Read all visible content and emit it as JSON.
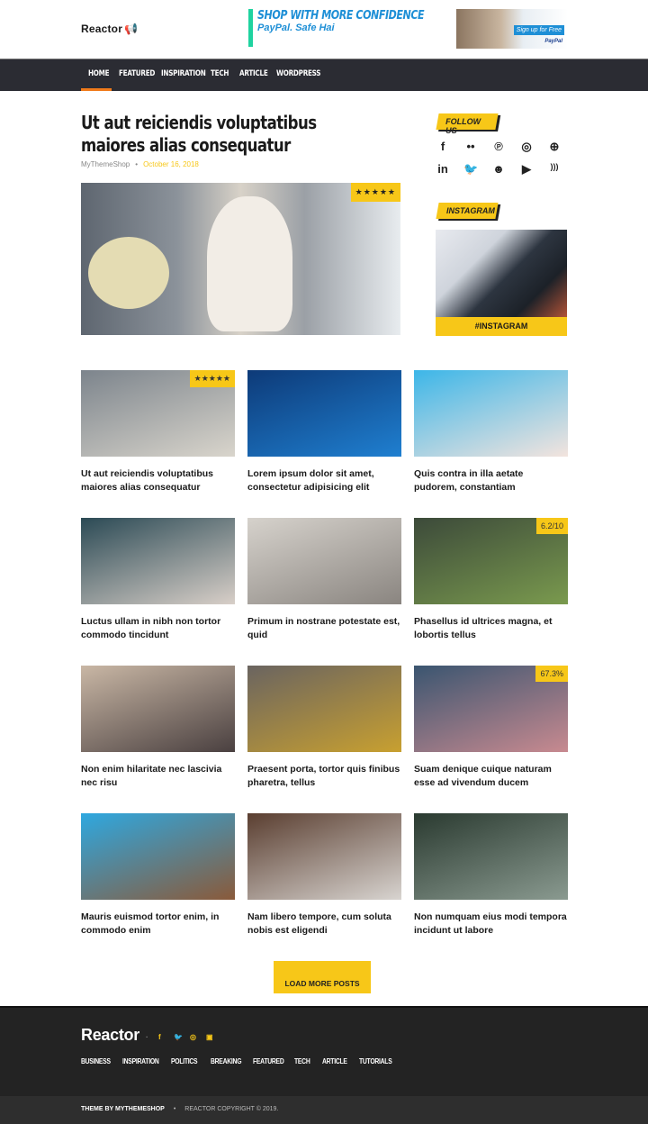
{
  "header": {
    "logo": "Reactor",
    "ad1_line1": "SHOP WITH MORE CONFIDENCE",
    "ad1_line2": "PayPal. Safe Hai",
    "ad2_cta": "Sign up for Free",
    "ad2_brand": "PayPal"
  },
  "nav": [
    "HOME",
    "FEATURED",
    "INSPIRATION",
    "TECH",
    "ARTICLE",
    "WORDPRESS"
  ],
  "featured": {
    "title": "Ut aut reiciendis voluptatibus maiores alias consequatur",
    "author": "MyThemeShop",
    "date": "October 16, 2018",
    "rating": "★★★★★"
  },
  "sidebar": {
    "follow_title": "FOLLOW US",
    "social": [
      "facebook-icon",
      "flickr-icon",
      "pinterest-icon",
      "instagram-icon",
      "dribbble-icon",
      "linkedin-icon",
      "twitter-icon",
      "github-icon",
      "youtube-icon",
      "rss-icon"
    ],
    "instagram_title": "INSTAGRAM",
    "instagram_tag": "#INSTAGRAM"
  },
  "posts": [
    {
      "title": "Ut aut reiciendis voluptatibus maiores alias consequatur",
      "badge": "★★★★★",
      "colors": [
        "#7c848c",
        "#d9d5cc"
      ]
    },
    {
      "title": "Lorem ipsum dolor sit amet, consectetur adipisicing elit",
      "badge": "",
      "colors": [
        "#0d3a78",
        "#1f7fd0"
      ]
    },
    {
      "title": "Quis contra in illa aetate pudorem, constantiam",
      "badge": "",
      "colors": [
        "#3cb6e8",
        "#f3e4de"
      ]
    },
    {
      "title": "Luctus ullam in nibh non tortor commodo tincidunt",
      "badge": "",
      "colors": [
        "#2b4a55",
        "#d8cfc8"
      ]
    },
    {
      "title": "Primum in nostrane potestate est, quid",
      "badge": "",
      "colors": [
        "#d6d2cc",
        "#8a8580"
      ]
    },
    {
      "title": "Phasellus id ultrices magna, et lobortis tellus",
      "badge": "6.2/10",
      "colors": [
        "#3c4a3a",
        "#7a9a4e"
      ]
    },
    {
      "title": "Non enim hilaritate nec lascivia nec risu",
      "badge": "",
      "colors": [
        "#c9b7a5",
        "#4a4040"
      ]
    },
    {
      "title": "Praesent porta, tortor quis finibus pharetra, tellus",
      "badge": "",
      "colors": [
        "#6a6460",
        "#c8a030"
      ]
    },
    {
      "title": "Suam denique cuique naturam esse ad vivendum ducem",
      "badge": "67.3%",
      "colors": [
        "#3a5570",
        "#c88a90"
      ]
    },
    {
      "title": "Mauris euismod tortor enim, in commodo enim",
      "badge": "",
      "colors": [
        "#2ea8e0",
        "#8a5a3a"
      ]
    },
    {
      "title": "Nam libero tempore, cum soluta nobis est eligendi",
      "badge": "",
      "colors": [
        "#5a3e30",
        "#d8d4d0"
      ]
    },
    {
      "title": "Non numquam eius modi tempora incidunt ut labore",
      "badge": "",
      "colors": [
        "#2a3a30",
        "#8a9a90"
      ]
    }
  ],
  "load_more": "LOAD MORE POSTS",
  "footer": {
    "logo": "Reactor",
    "nav": [
      "BUSINESS",
      "INSPIRATION",
      "POLITICS",
      "BREAKING",
      "FEATURED",
      "TECH",
      "ARTICLE",
      "TUTORIALS"
    ],
    "theme_by": "THEME BY MYTHEMESHOP",
    "copyright": "REACTOR COPYRIGHT © 2019."
  },
  "colors": {
    "accent": "#f7c718",
    "nav_bg": "#2b2c33",
    "active": "#f07a1a",
    "footer_bg": "#232323"
  }
}
